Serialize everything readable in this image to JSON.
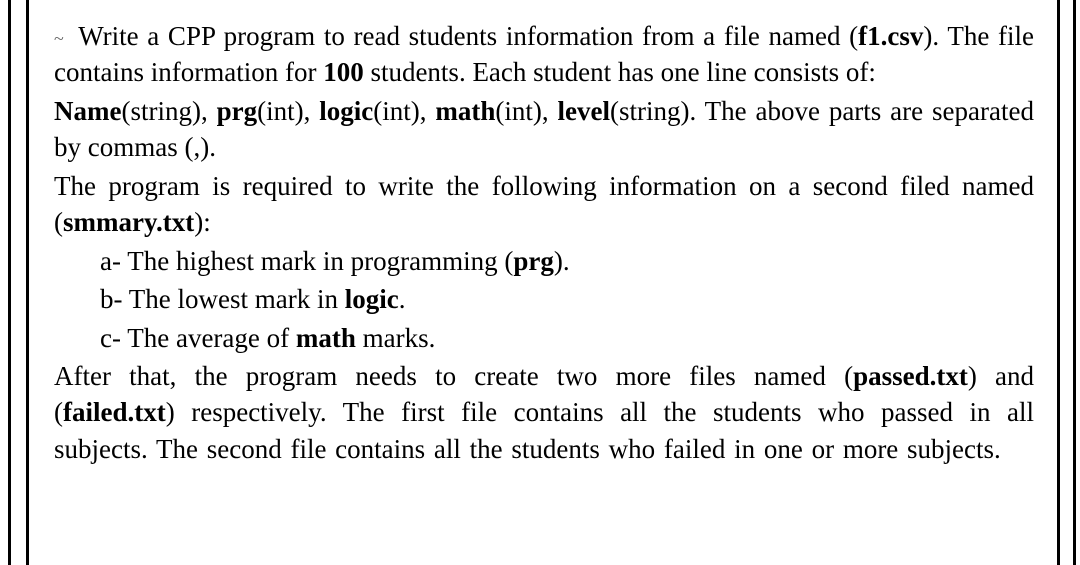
{
  "intro_lead": "Write a CPP program to read students information from a file named (",
  "file1": "f1.csv",
  "intro_mid": "). The file contains information for ",
  "count": "100",
  "intro_tail": " students. Each student has one line consists of:",
  "fields_name": "Name",
  "fields_name_type": "(string), ",
  "fields_prg": "prg",
  "fields_prg_type": "(int), ",
  "fields_logic": "logic",
  "fields_logic_type": "(int), ",
  "fields_math": "math",
  "fields_math_type": "(int), ",
  "fields_level": "level",
  "fields_level_type": "(string). The above parts are separated by commas (,).",
  "summary_lead": "The program is required to write the following information on a second filed named (",
  "file2": "smmary.txt",
  "summary_tail": "):",
  "item_a_lead": "a-  The highest mark in programming (",
  "item_a_bold": "prg",
  "item_a_tail": ").",
  "item_b_lead": "b-  The lowest mark in ",
  "item_b_bold": "logic",
  "item_b_tail": ".",
  "item_c_lead": "c-  The average of ",
  "item_c_bold": "math",
  "item_c_tail": " marks.",
  "after_lead": "After that, the program needs to create two more files named (",
  "file3": "passed.txt",
  "after_mid1": ") and (",
  "file4": "failed.txt",
  "after_tail": ") respectively. The first file contains all the students who passed in all subjects. The second file contains all the students who failed in one or more subjects.",
  "tilde": "~  "
}
